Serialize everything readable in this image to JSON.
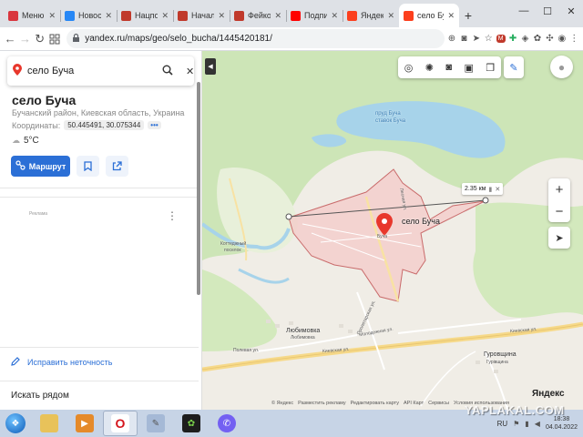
{
  "browser": {
    "tabs": [
      {
        "label": "Меню",
        "favicon": "#d9363e",
        "icon": "grid-icon",
        "active": false
      },
      {
        "label": "Новости",
        "favicon": "#2787f5",
        "icon": "vk-icon",
        "active": false
      },
      {
        "label": "Нацполя",
        "favicon": "#c0392b",
        "icon": "yaplakal-icon",
        "active": false
      },
      {
        "label": "Начался",
        "favicon": "#c0392b",
        "icon": "yaplakal-icon",
        "active": false
      },
      {
        "label": "Фейкову",
        "favicon": "#c0392b",
        "icon": "yaplakal-icon",
        "active": false
      },
      {
        "label": "Подпись",
        "favicon": "#ff0000",
        "icon": "youtube-icon",
        "active": false
      },
      {
        "label": "Яндекс",
        "favicon": "#fc3f1d",
        "icon": "yandex-icon",
        "active": false
      },
      {
        "label": "село Бу",
        "favicon": "#fc3f1d",
        "icon": "maps-pin-icon",
        "active": true
      }
    ],
    "new_tab": "+",
    "window_controls": {
      "minimize": "—",
      "maximize": "☐",
      "close": "✕"
    },
    "url": "yandex.ru/maps/geo/selo_bucha/1445420181/"
  },
  "panel": {
    "search_value": "село Буча",
    "title": "село Буча",
    "region": "Бучанский район, Киевская область, Украина",
    "coords_label": "Координаты:",
    "coords_value": "50.445491, 30.075344",
    "coords_more": "•••",
    "weather": "5°C",
    "route_label": "Маршрут",
    "ad_label": "Реклама",
    "fix_label": "Исправить неточность",
    "search_near": "Искать рядом"
  },
  "map": {
    "distance": "2.35 км",
    "marker_label": "село Буча",
    "labels": {
      "lake": "пруд Буча",
      "lake2": "ставок Буча",
      "village": "Буча",
      "cottage": "Коттеджный",
      "cottage2": "поселок",
      "lyubimovka": "Любимовка",
      "lyubimovka2": "Любимовка",
      "gurovshchina": "Гуровщина",
      "gurovshchina2": "Гурівщина",
      "polevaya": "Полевая ул.",
      "kievskaya": "Киевская ул.",
      "kievskaya2": "Киевская ул.",
      "molodezhnaya": "Молодежная ул.",
      "prolet": "Пролетарская ул.",
      "lesnaya": "Лесная ул."
    },
    "logo": "Яндекс",
    "attribution": [
      "© Яндекс",
      "Разместить рекламу",
      "Редактировать карту",
      "API Карт",
      "Сервисы",
      "Условия использования"
    ],
    "colors": {
      "area_fill": "#f4c9c8",
      "area_stroke": "#c96b6b",
      "forest": "#cde5b7",
      "water": "#a7d3ea",
      "road_major": "#f6d989",
      "accent": "#2b6fd6",
      "marker": "#e8372c"
    }
  },
  "taskbar": {
    "lang": "RU",
    "time": "18:38",
    "date": "04.04.2022",
    "watermark": "YAPLAKAL.COM"
  }
}
